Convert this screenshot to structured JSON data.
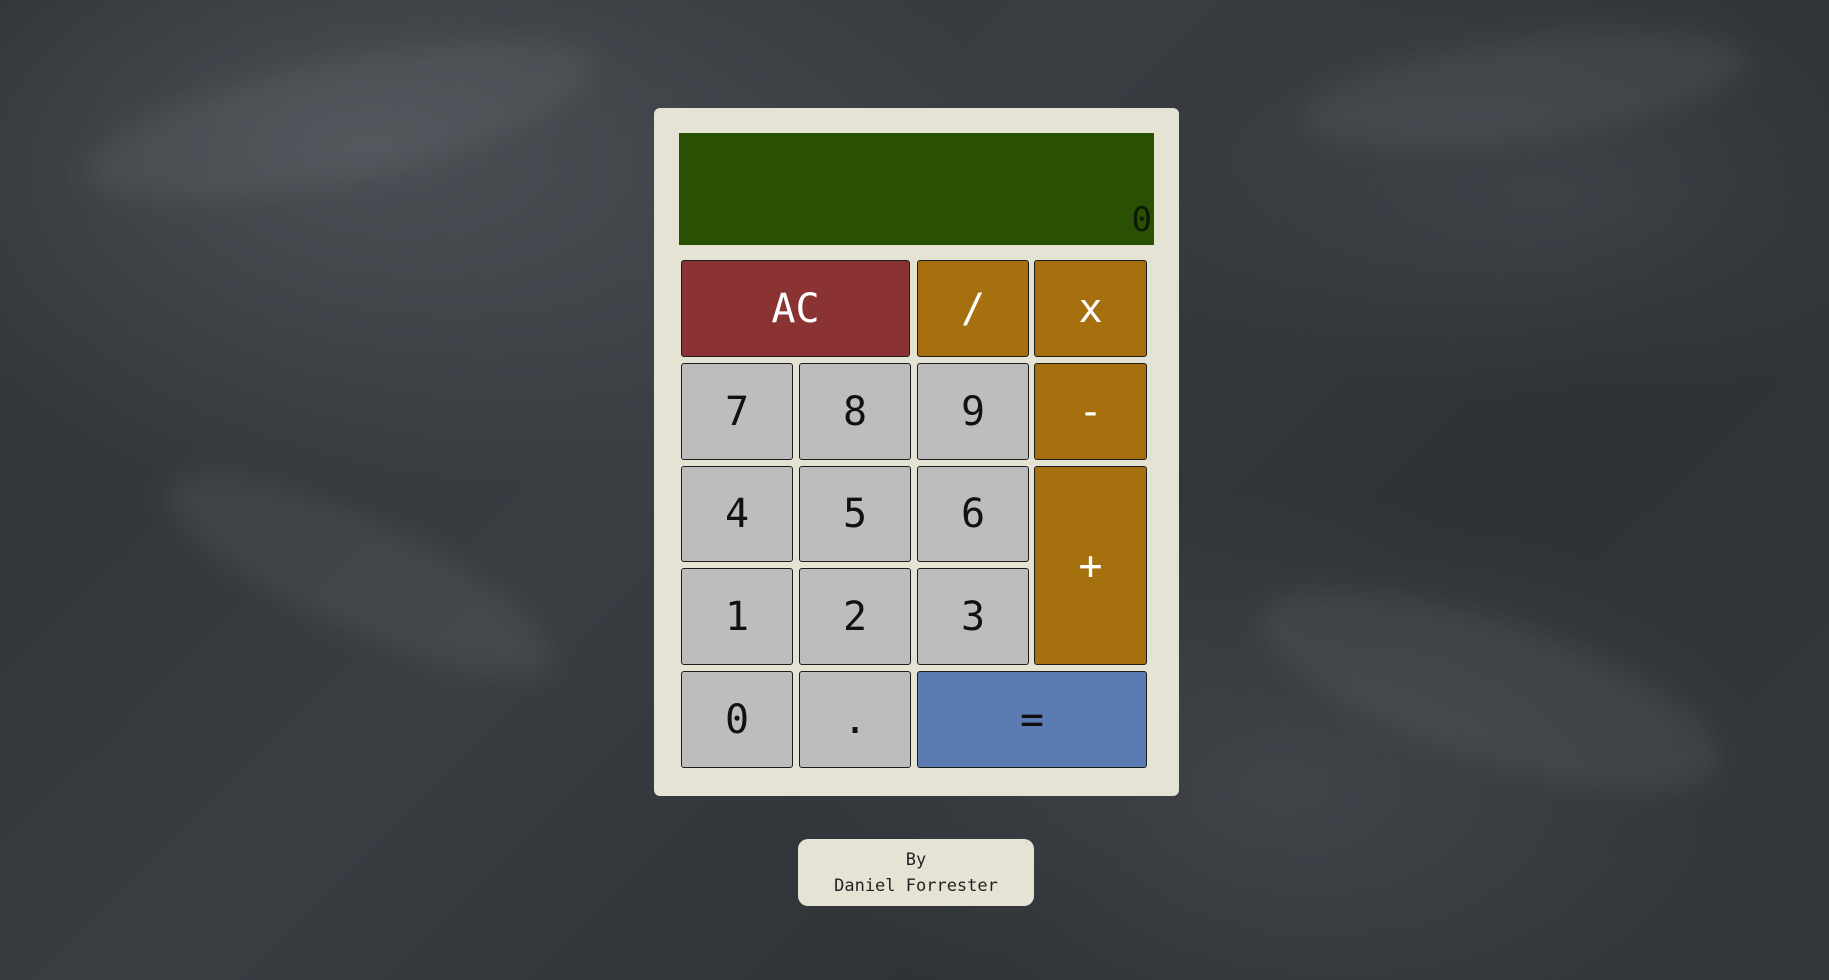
{
  "display": {
    "value": "0"
  },
  "keys": {
    "clear": "AC",
    "divide": "/",
    "multiply": "x",
    "subtract": "-",
    "add": "+",
    "equals": "=",
    "decimal": ".",
    "d0": "0",
    "d1": "1",
    "d2": "2",
    "d3": "3",
    "d4": "4",
    "d5": "5",
    "d6": "6",
    "d7": "7",
    "d8": "8",
    "d9": "9"
  },
  "credit": {
    "line1": "By",
    "line2": "Daniel Forrester"
  },
  "colors": {
    "display_bg": "#2a5103",
    "clear_key": "#8b3232",
    "operator_key": "#a7700f",
    "number_key": "#bdbdbd",
    "equals_key": "#5b7bb3",
    "panel": "#e5e3d4"
  }
}
